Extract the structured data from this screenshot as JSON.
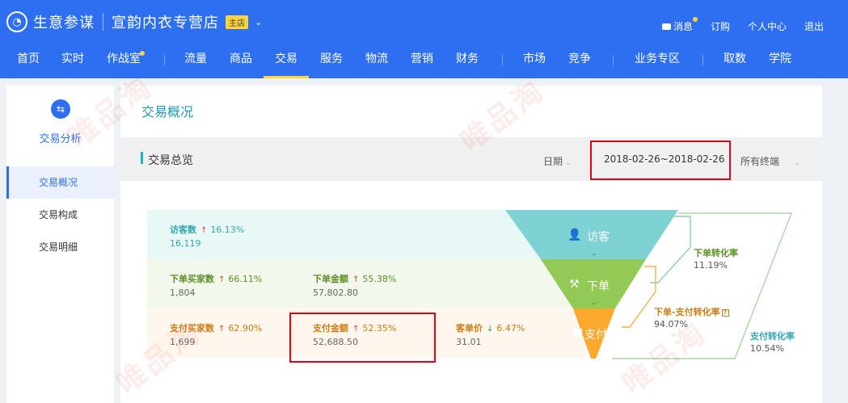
{
  "header": {
    "brand": "生意参谋",
    "store_name": "宣韵内衣专营店",
    "store_badge": "主店",
    "user_links": {
      "message": "消息",
      "order": "订购",
      "personal": "个人中心",
      "logout": "退出"
    }
  },
  "nav": {
    "items": [
      {
        "label": "首页"
      },
      {
        "label": "实时"
      },
      {
        "label": "作战室"
      },
      {
        "label": "流量"
      },
      {
        "label": "商品"
      },
      {
        "label": "交易"
      },
      {
        "label": "服务"
      },
      {
        "label": "物流"
      },
      {
        "label": "营销"
      },
      {
        "label": "财务"
      },
      {
        "label": "市场"
      },
      {
        "label": "竞争"
      },
      {
        "label": "业务专区"
      },
      {
        "label": "取数"
      },
      {
        "label": "学院"
      }
    ],
    "active": "交易"
  },
  "sidebar": {
    "title": "交易分析",
    "items": [
      {
        "label": "交易概况"
      },
      {
        "label": "交易构成"
      },
      {
        "label": "交易明细"
      }
    ],
    "active": "交易概况"
  },
  "main": {
    "page_title": "交易概况",
    "section_title": "交易总览",
    "date_label": "日期",
    "date_range": "2018-02-26~2018-02-26",
    "terminal": "所有终端"
  },
  "metrics": {
    "visitors": {
      "label": "访客数",
      "change": "16.13%",
      "direction": "up",
      "value": "16,119"
    },
    "order_buyers": {
      "label": "下单买家数",
      "change": "66.11%",
      "direction": "up",
      "value": "1,804"
    },
    "order_amount": {
      "label": "下单金额",
      "change": "55.38%",
      "direction": "up",
      "value": "57,802.80"
    },
    "pay_buyers": {
      "label": "支付买家数",
      "change": "62.90%",
      "direction": "up",
      "value": "1,699"
    },
    "pay_amount": {
      "label": "支付金额",
      "change": "52.35%",
      "direction": "up",
      "value": "52,688.50"
    },
    "avg_order": {
      "label": "客单价",
      "change": "6.47%",
      "direction": "down",
      "value": "31.01"
    }
  },
  "funnel": {
    "stages": [
      {
        "label": "访客",
        "color": "#7fd2d4"
      },
      {
        "label": "下单",
        "color": "#93ca56"
      },
      {
        "label": "支付",
        "color": "#fba82f"
      }
    ],
    "rates": [
      {
        "label": "下单转化率",
        "value": "11.19%"
      },
      {
        "label": "下单-支付转化率",
        "value": "94.07%"
      },
      {
        "label": "支付转化率",
        "value": "10.54%"
      }
    ]
  },
  "watermark": "唯品淘",
  "colors": {
    "header": "#2d6ff0",
    "highlight": "#e60012",
    "accent_yellow": "#ffd33a"
  }
}
